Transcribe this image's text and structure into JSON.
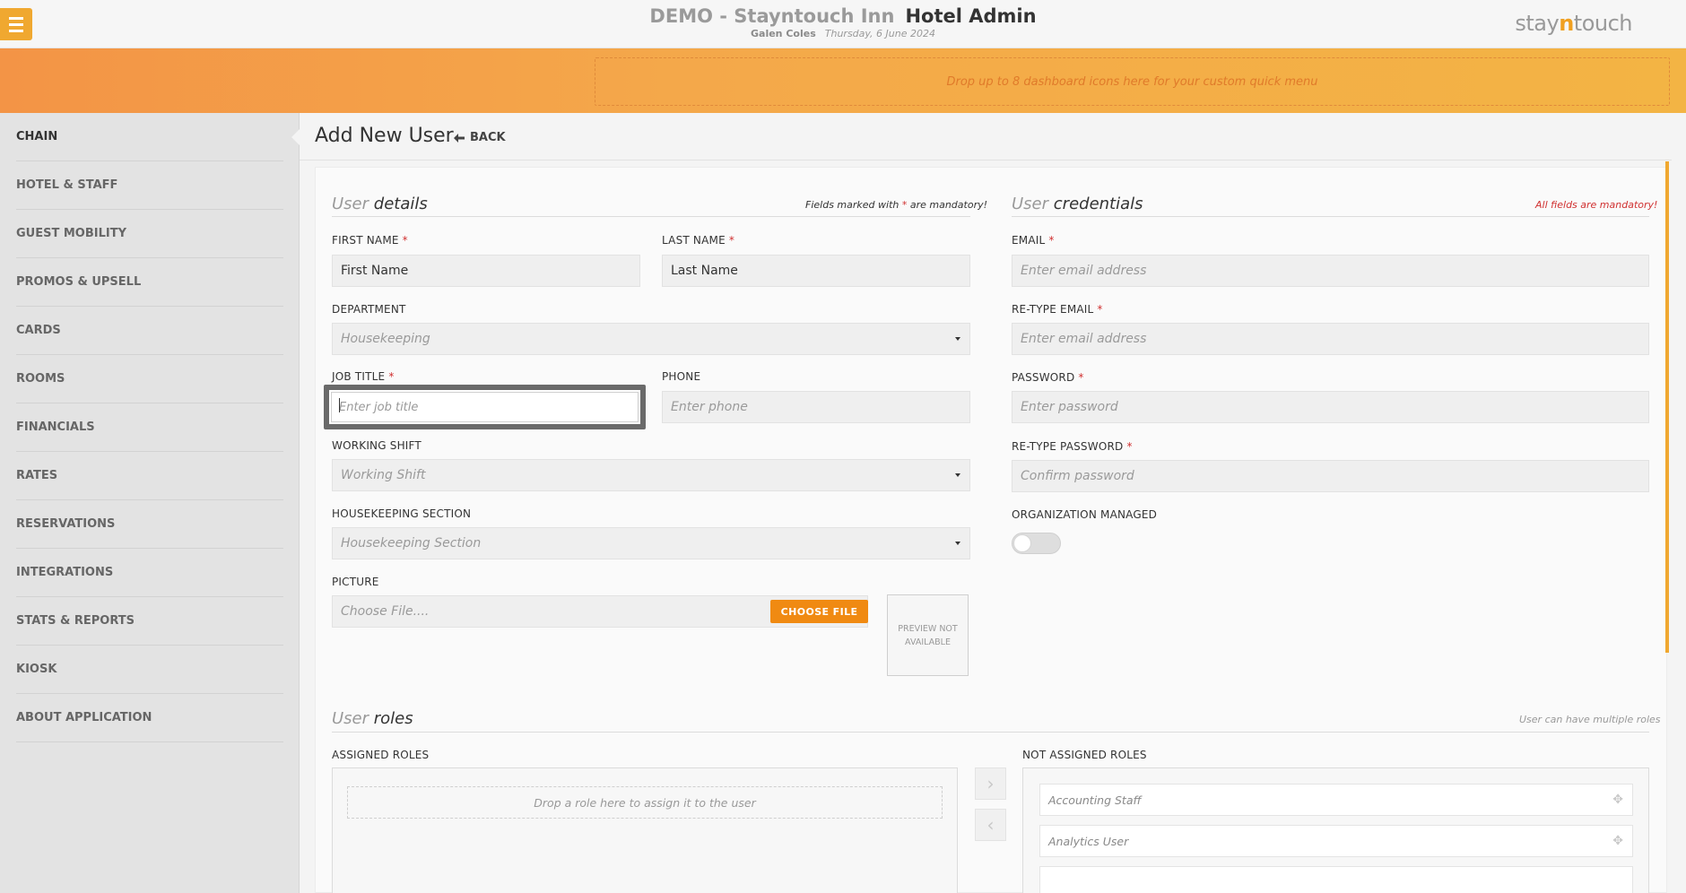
{
  "header": {
    "hotel_name": "DEMO - Stayntouch Inn",
    "app_name": "Hotel Admin",
    "user_name": "Galen Coles",
    "date": "Thursday, 6 June 2024",
    "logo_pre": "stay",
    "logo_n": "n",
    "logo_post": "touch"
  },
  "banner": {
    "dropzone_text": "Drop up to 8 dashboard icons here for your custom quick menu"
  },
  "sidebar": {
    "items": [
      {
        "label": "CHAIN",
        "active": true
      },
      {
        "label": "HOTEL & STAFF"
      },
      {
        "label": "GUEST MOBILITY"
      },
      {
        "label": "PROMOS & UPSELL"
      },
      {
        "label": "CARDS"
      },
      {
        "label": "ROOMS"
      },
      {
        "label": "FINANCIALS"
      },
      {
        "label": "RATES"
      },
      {
        "label": "RESERVATIONS"
      },
      {
        "label": "INTEGRATIONS"
      },
      {
        "label": "STATS & REPORTS"
      },
      {
        "label": "KIOSK"
      },
      {
        "label": "ABOUT APPLICATION"
      }
    ]
  },
  "page": {
    "title": "Add New User",
    "back_label": "BACK"
  },
  "user_details": {
    "heading_light": "User",
    "heading": "details",
    "mandatory_note_pre": "Fields marked with ",
    "mandatory_star": "*",
    "mandatory_note_post": " are mandatory!",
    "first_name_label": "FIRST NAME",
    "first_name_value": "First Name",
    "last_name_label": "LAST NAME",
    "last_name_value": "Last Name",
    "department_label": "DEPARTMENT",
    "department_value": "Housekeeping",
    "job_title_label": "JOB TITLE",
    "job_title_placeholder": "Enter job title",
    "phone_label": "PHONE",
    "phone_placeholder": "Enter phone",
    "working_shift_label": "WORKING SHIFT",
    "working_shift_value": "Working Shift",
    "housekeeping_section_label": "HOUSEKEEPING SECTION",
    "housekeeping_section_value": "Housekeeping Section",
    "picture_label": "PICTURE",
    "picture_placeholder": "Choose File....",
    "choose_file_label": "CHOOSE FILE",
    "preview_text": "PREVIEW NOT AVAILABLE"
  },
  "credentials": {
    "heading_light": "User",
    "heading": "credentials",
    "mandatory_note": "All fields are mandatory!",
    "email_label": "EMAIL",
    "email_placeholder": "Enter email address",
    "retype_email_label": "RE-TYPE EMAIL",
    "retype_email_placeholder": "Enter email address",
    "password_label": "PASSWORD",
    "password_placeholder": "Enter password",
    "retype_password_label": "RE-TYPE PASSWORD",
    "retype_password_placeholder": "Confirm password",
    "org_managed_label": "ORGANIZATION MANAGED",
    "org_managed": false
  },
  "roles": {
    "heading_light": "User",
    "heading": "roles",
    "note": "User can have multiple roles",
    "assigned_label": "ASSIGNED ROLES",
    "drop_text": "Drop a role here to assign it to the user",
    "not_assigned_label": "NOT ASSIGNED ROLES",
    "not_assigned": [
      "Accounting Staff",
      "Analytics User"
    ]
  },
  "colors": {
    "accent": "#f0a830",
    "button": "#f08a12",
    "required": "#d03030"
  }
}
